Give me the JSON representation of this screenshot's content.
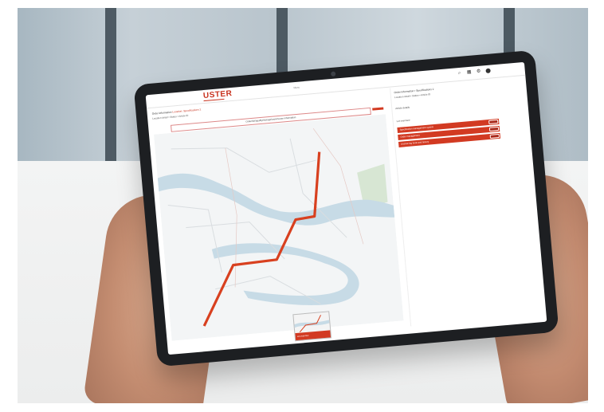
{
  "screen": {
    "logo": "USTER",
    "top_center": "Menu",
    "meta_line1_prefix": "Order information",
    "meta_line1_link": "Location: Specifications 2",
    "meta_line2": "Location detail  •  Status  •  Article ID",
    "search_placeholder": "Order/lot/quality/storage/warehouse information",
    "thumbnail_label": "Lot overview"
  },
  "sidebar": {
    "title": "Order information  •  Specifications 2",
    "subtitle": "Location detail  •  Status  •  Article ID",
    "label_1": "Article details",
    "label_2": "Lot overview",
    "items": [
      {
        "label": "Specification management system"
      },
      {
        "label": "Order management"
      },
      {
        "label": "Archive log book and history"
      }
    ]
  },
  "colors": {
    "accent": "#d23a22",
    "route": "#d8401f",
    "river": "#c7dbe6",
    "park": "#d7e6d3"
  },
  "icons": [
    "search-icon",
    "grid-icon",
    "settings-icon",
    "user-icon"
  ]
}
